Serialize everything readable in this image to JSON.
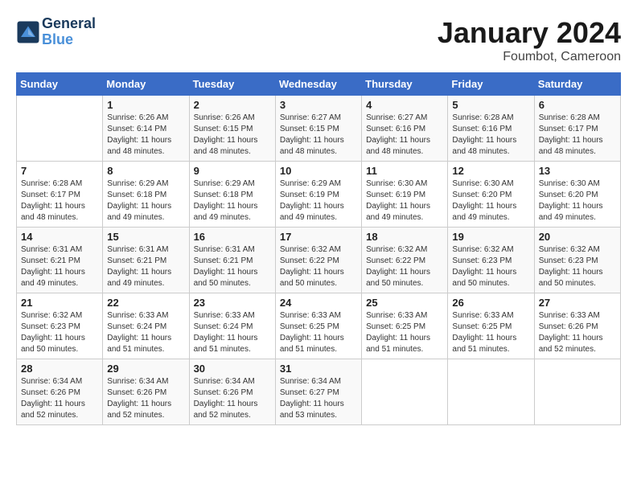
{
  "header": {
    "logo_line1": "General",
    "logo_line2": "Blue",
    "title": "January 2024",
    "subtitle": "Foumbot, Cameroon"
  },
  "days_of_week": [
    "Sunday",
    "Monday",
    "Tuesday",
    "Wednesday",
    "Thursday",
    "Friday",
    "Saturday"
  ],
  "weeks": [
    [
      {
        "day": "",
        "info": ""
      },
      {
        "day": "1",
        "info": "Sunrise: 6:26 AM\nSunset: 6:14 PM\nDaylight: 11 hours\nand 48 minutes."
      },
      {
        "day": "2",
        "info": "Sunrise: 6:26 AM\nSunset: 6:15 PM\nDaylight: 11 hours\nand 48 minutes."
      },
      {
        "day": "3",
        "info": "Sunrise: 6:27 AM\nSunset: 6:15 PM\nDaylight: 11 hours\nand 48 minutes."
      },
      {
        "day": "4",
        "info": "Sunrise: 6:27 AM\nSunset: 6:16 PM\nDaylight: 11 hours\nand 48 minutes."
      },
      {
        "day": "5",
        "info": "Sunrise: 6:28 AM\nSunset: 6:16 PM\nDaylight: 11 hours\nand 48 minutes."
      },
      {
        "day": "6",
        "info": "Sunrise: 6:28 AM\nSunset: 6:17 PM\nDaylight: 11 hours\nand 48 minutes."
      }
    ],
    [
      {
        "day": "7",
        "info": "Sunrise: 6:28 AM\nSunset: 6:17 PM\nDaylight: 11 hours\nand 48 minutes."
      },
      {
        "day": "8",
        "info": "Sunrise: 6:29 AM\nSunset: 6:18 PM\nDaylight: 11 hours\nand 49 minutes."
      },
      {
        "day": "9",
        "info": "Sunrise: 6:29 AM\nSunset: 6:18 PM\nDaylight: 11 hours\nand 49 minutes."
      },
      {
        "day": "10",
        "info": "Sunrise: 6:29 AM\nSunset: 6:19 PM\nDaylight: 11 hours\nand 49 minutes."
      },
      {
        "day": "11",
        "info": "Sunrise: 6:30 AM\nSunset: 6:19 PM\nDaylight: 11 hours\nand 49 minutes."
      },
      {
        "day": "12",
        "info": "Sunrise: 6:30 AM\nSunset: 6:20 PM\nDaylight: 11 hours\nand 49 minutes."
      },
      {
        "day": "13",
        "info": "Sunrise: 6:30 AM\nSunset: 6:20 PM\nDaylight: 11 hours\nand 49 minutes."
      }
    ],
    [
      {
        "day": "14",
        "info": "Sunrise: 6:31 AM\nSunset: 6:21 PM\nDaylight: 11 hours\nand 49 minutes."
      },
      {
        "day": "15",
        "info": "Sunrise: 6:31 AM\nSunset: 6:21 PM\nDaylight: 11 hours\nand 49 minutes."
      },
      {
        "day": "16",
        "info": "Sunrise: 6:31 AM\nSunset: 6:21 PM\nDaylight: 11 hours\nand 50 minutes."
      },
      {
        "day": "17",
        "info": "Sunrise: 6:32 AM\nSunset: 6:22 PM\nDaylight: 11 hours\nand 50 minutes."
      },
      {
        "day": "18",
        "info": "Sunrise: 6:32 AM\nSunset: 6:22 PM\nDaylight: 11 hours\nand 50 minutes."
      },
      {
        "day": "19",
        "info": "Sunrise: 6:32 AM\nSunset: 6:23 PM\nDaylight: 11 hours\nand 50 minutes."
      },
      {
        "day": "20",
        "info": "Sunrise: 6:32 AM\nSunset: 6:23 PM\nDaylight: 11 hours\nand 50 minutes."
      }
    ],
    [
      {
        "day": "21",
        "info": "Sunrise: 6:32 AM\nSunset: 6:23 PM\nDaylight: 11 hours\nand 50 minutes."
      },
      {
        "day": "22",
        "info": "Sunrise: 6:33 AM\nSunset: 6:24 PM\nDaylight: 11 hours\nand 51 minutes."
      },
      {
        "day": "23",
        "info": "Sunrise: 6:33 AM\nSunset: 6:24 PM\nDaylight: 11 hours\nand 51 minutes."
      },
      {
        "day": "24",
        "info": "Sunrise: 6:33 AM\nSunset: 6:25 PM\nDaylight: 11 hours\nand 51 minutes."
      },
      {
        "day": "25",
        "info": "Sunrise: 6:33 AM\nSunset: 6:25 PM\nDaylight: 11 hours\nand 51 minutes."
      },
      {
        "day": "26",
        "info": "Sunrise: 6:33 AM\nSunset: 6:25 PM\nDaylight: 11 hours\nand 51 minutes."
      },
      {
        "day": "27",
        "info": "Sunrise: 6:33 AM\nSunset: 6:26 PM\nDaylight: 11 hours\nand 52 minutes."
      }
    ],
    [
      {
        "day": "28",
        "info": "Sunrise: 6:34 AM\nSunset: 6:26 PM\nDaylight: 11 hours\nand 52 minutes."
      },
      {
        "day": "29",
        "info": "Sunrise: 6:34 AM\nSunset: 6:26 PM\nDaylight: 11 hours\nand 52 minutes."
      },
      {
        "day": "30",
        "info": "Sunrise: 6:34 AM\nSunset: 6:26 PM\nDaylight: 11 hours\nand 52 minutes."
      },
      {
        "day": "31",
        "info": "Sunrise: 6:34 AM\nSunset: 6:27 PM\nDaylight: 11 hours\nand 53 minutes."
      },
      {
        "day": "",
        "info": ""
      },
      {
        "day": "",
        "info": ""
      },
      {
        "day": "",
        "info": ""
      }
    ]
  ]
}
